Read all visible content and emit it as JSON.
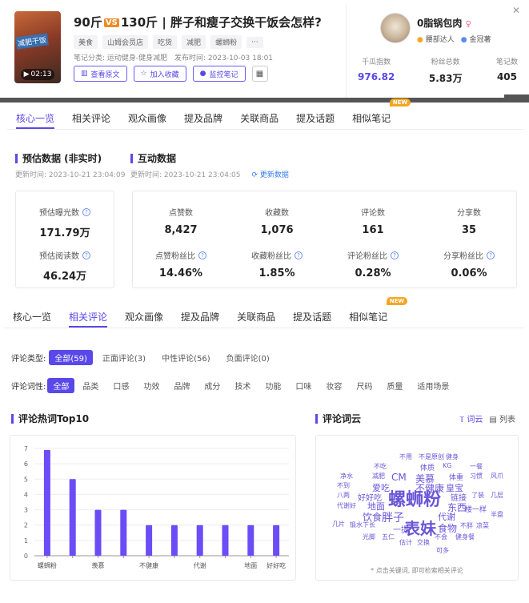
{
  "video": {
    "duration": "02:13",
    "thumb_text": "减肥干饭",
    "title_pre": "90斤",
    "title_vs": "VS",
    "title_post": "130斤 | 胖子和瘦子交换干饭会怎样?",
    "tags": [
      "美食",
      "山姆会员店",
      "吃货",
      "减肥",
      "螺蛳粉",
      "···"
    ],
    "category": "笔记分类: 运动健身-健身减肥",
    "publish": "发布时间: 2023-10-03 18:01",
    "buttons": [
      "查看原文",
      "加入收藏",
      "监控笔记"
    ]
  },
  "user": {
    "name": "0脂锅包肉",
    "badge1": "腰部达人",
    "badge2": "金冠薯",
    "stats": [
      {
        "label": "千瓜指数",
        "value": "976.82"
      },
      {
        "label": "粉丝总数",
        "value": "5.83万"
      },
      {
        "label": "笔记数",
        "value": "405"
      }
    ]
  },
  "tabs": [
    "核心一览",
    "相关评论",
    "观众画像",
    "提及品牌",
    "关联商品",
    "提及话题",
    "相似笔记"
  ],
  "new_badge": "NEW",
  "estimate": {
    "title": "预估数据 (非实时)",
    "updated": "更新时间: 2023-10-21 23:04:09",
    "exposure_label": "预估曝光数",
    "exposure": "171.79万",
    "read_label": "预估阅读数",
    "read": "46.24万"
  },
  "interact": {
    "title": "互动数据",
    "updated": "更新时间: 2023-10-21 23:04:05",
    "refresh": "更新数据",
    "metrics": [
      {
        "label": "点赞数",
        "value": "8,427"
      },
      {
        "label": "收藏数",
        "value": "1,076"
      },
      {
        "label": "评论数",
        "value": "161"
      },
      {
        "label": "分享数",
        "value": "35"
      },
      {
        "label": "点赞粉丝比",
        "value": "14.46%"
      },
      {
        "label": "收藏粉丝比",
        "value": "1.85%"
      },
      {
        "label": "评论粉丝比",
        "value": "0.28%"
      },
      {
        "label": "分享粉丝比",
        "value": "0.06%"
      }
    ]
  },
  "filters": {
    "type_label": "评论类型:",
    "types": [
      "全部(59)",
      "正面评论(3)",
      "中性评论(56)",
      "负面评论(0)"
    ],
    "word_label": "评论词性:",
    "words": [
      "全部",
      "品类",
      "口感",
      "功效",
      "品牌",
      "成分",
      "技术",
      "功能",
      "口味",
      "妆容",
      "尺码",
      "质量",
      "适用场景"
    ]
  },
  "top10": {
    "title": "评论热词Top10"
  },
  "cloud": {
    "title": "评论词云",
    "toggle_cloud": "词云",
    "toggle_list": "列表",
    "footer": "* 点击关键词, 即可检索相关评论",
    "words": [
      {
        "t": "不用"
      },
      {
        "t": "不是原创"
      },
      {
        "t": "健身"
      },
      {
        "t": "不吃"
      },
      {
        "t": "体质"
      },
      {
        "t": "KG"
      },
      {
        "t": "一餐"
      },
      {
        "t": "净水"
      },
      {
        "t": "减肥"
      },
      {
        "t": "CM"
      },
      {
        "t": "美慕"
      },
      {
        "t": "体重"
      },
      {
        "t": "习惯"
      },
      {
        "t": "风爪"
      },
      {
        "t": "不到"
      },
      {
        "t": "爱吃"
      },
      {
        "t": "不健康"
      },
      {
        "t": "皇宝"
      },
      {
        "t": "八两"
      },
      {
        "t": "好好吃"
      },
      {
        "t": "螺蛳粉"
      },
      {
        "t": "链接"
      },
      {
        "t": "了装"
      },
      {
        "t": "几层"
      },
      {
        "t": "代谢好"
      },
      {
        "t": "地面"
      },
      {
        "t": "东西"
      },
      {
        "t": "楼一样"
      },
      {
        "t": "饮食"
      },
      {
        "t": "胖子"
      },
      {
        "t": "代谢"
      },
      {
        "t": "半盘"
      },
      {
        "t": "几片"
      },
      {
        "t": "锻水下长"
      },
      {
        "t": "一提"
      },
      {
        "t": "表妹"
      },
      {
        "t": "食物"
      },
      {
        "t": "不胖"
      },
      {
        "t": "凉菜"
      },
      {
        "t": "光脚"
      },
      {
        "t": "五仁"
      },
      {
        "t": "不会"
      },
      {
        "t": "健身餐"
      },
      {
        "t": "估计"
      },
      {
        "t": "交换"
      },
      {
        "t": "可多"
      }
    ]
  },
  "chart_data": {
    "type": "bar",
    "title": "评论热词Top10",
    "categories": [
      "螺蛳粉",
      "",
      "羡慕",
      "",
      "不健康",
      "",
      "代谢",
      "",
      "地面",
      "好好吃"
    ],
    "values": [
      6.9,
      5.0,
      3.0,
      3.0,
      2.0,
      2.0,
      2.0,
      2.0,
      2.0,
      2.0
    ],
    "yticks": [
      0,
      1,
      2,
      3,
      4,
      5,
      6,
      7
    ],
    "ylim": [
      0,
      7
    ],
    "color": "#6b4cf6"
  }
}
